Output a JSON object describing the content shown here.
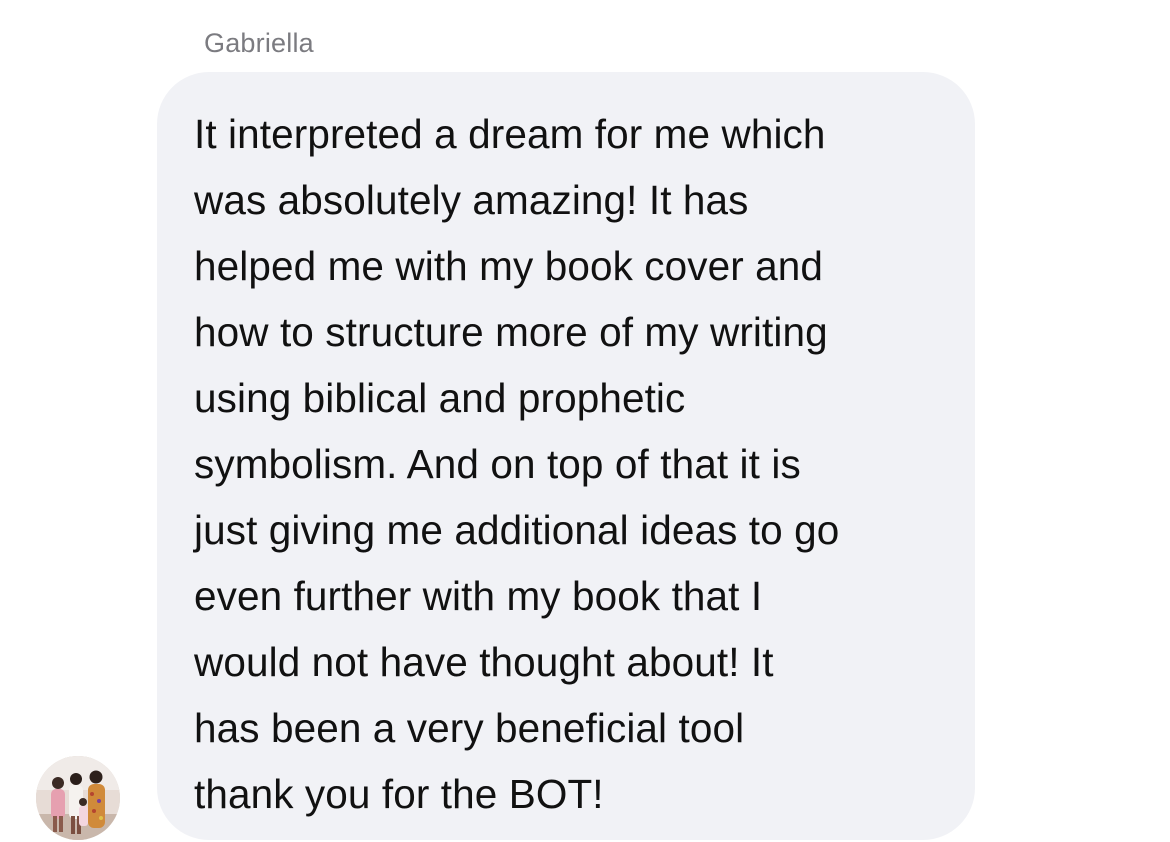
{
  "message": {
    "sender": "Gabriella",
    "lines": [
      "It interpreted a dream for me which",
      "was absolutely amazing! It has",
      "helped me with my book cover and",
      "how to structure more of my writing",
      "using biblical and prophetic",
      "symbolism. And on top of that it is",
      "just giving me additional ideas to go",
      "even further with my book that I",
      "would not have thought about! It",
      "has been a very beneficial tool",
      "thank you for the BOT!"
    ]
  },
  "avatar": {
    "icon": "profile-photo-avatar"
  },
  "colors": {
    "bubble_background": "#f1f2f6",
    "message_text": "#111111",
    "sender_text": "#7b7b80",
    "page_background": "#ffffff"
  }
}
